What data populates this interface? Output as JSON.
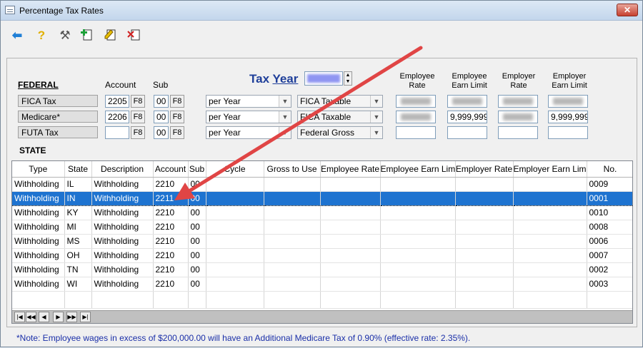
{
  "window": {
    "title": "Percentage Tax Rates",
    "close_glyph": "✕"
  },
  "toolbar": {
    "icons": [
      "back-arrow-icon",
      "help-icon",
      "tools-icon",
      "add-document-icon",
      "edit-document-icon",
      "delete-document-icon"
    ]
  },
  "federal": {
    "heading": "FEDERAL",
    "account_header": "Account",
    "sub_header": "Sub",
    "tax_year_label_a": "Tax ",
    "tax_year_label_b": "Year",
    "col_employee_rate": "Employee Rate",
    "col_employee_earn_limit": "Employee Earn Limit",
    "col_employer_rate": "Employer Rate",
    "col_employer_earn_limit": "Employer Earn Limit",
    "f8": "F8",
    "rows": [
      {
        "name": "FICA Tax",
        "account": "2205",
        "sub": "00",
        "cycle": "per Year",
        "gross": "FICA Taxable",
        "employee_earn_limit": "",
        "employer_earn_limit": ""
      },
      {
        "name": "Medicare*",
        "account": "2206",
        "sub": "00",
        "cycle": "per Year",
        "gross": "FICA Taxable",
        "employee_earn_limit": "9,999,999",
        "employer_earn_limit": "9,999,999"
      },
      {
        "name": "FUTA Tax",
        "account": "",
        "sub": "00",
        "cycle": "per Year",
        "gross": "Federal Gross",
        "employee_earn_limit": "",
        "employer_earn_limit": ""
      }
    ]
  },
  "state": {
    "heading": "STATE",
    "columns": [
      "Type",
      "State",
      "Description",
      "Account",
      "Sub",
      "Cycle",
      "Gross to Use",
      "Employee Rate",
      "Employee Earn Limit",
      "Employer Rate",
      "Employer Earn Limit",
      "No."
    ],
    "rows": [
      {
        "type": "Withholding",
        "state": "IL",
        "description": "Withholding",
        "account": "2210",
        "sub": "00",
        "no": "0009"
      },
      {
        "type": "Withholding",
        "state": "IN",
        "description": "Withholding",
        "account": "2211",
        "sub": "00",
        "no": "0001"
      },
      {
        "type": "Withholding",
        "state": "KY",
        "description": "Withholding",
        "account": "2210",
        "sub": "00",
        "no": "0010"
      },
      {
        "type": "Withholding",
        "state": "MI",
        "description": "Withholding",
        "account": "2210",
        "sub": "00",
        "no": "0008"
      },
      {
        "type": "Withholding",
        "state": "MS",
        "description": "Withholding",
        "account": "2210",
        "sub": "00",
        "no": "0006"
      },
      {
        "type": "Withholding",
        "state": "OH",
        "description": "Withholding",
        "account": "2210",
        "sub": "00",
        "no": "0007"
      },
      {
        "type": "Withholding",
        "state": "TN",
        "description": "Withholding",
        "account": "2210",
        "sub": "00",
        "no": "0002"
      },
      {
        "type": "Withholding",
        "state": "WI",
        "description": "Withholding",
        "account": "2210",
        "sub": "00",
        "no": "0003"
      }
    ],
    "selected_index": 1,
    "nav_buttons": [
      "|◀",
      "◀◀",
      "◀",
      "▶",
      "▶▶",
      "▶|"
    ]
  },
  "note": "*Note: Employee wages in excess of $200,000.00 will have an Additional Medicare Tax of 0.90% (effective rate: 2.35%).",
  "colors": {
    "selection": "#1e73d0",
    "annotation_arrow": "#e04545",
    "tax_year_label": "#1f3f9a",
    "note_text": "#1a2fa8"
  }
}
